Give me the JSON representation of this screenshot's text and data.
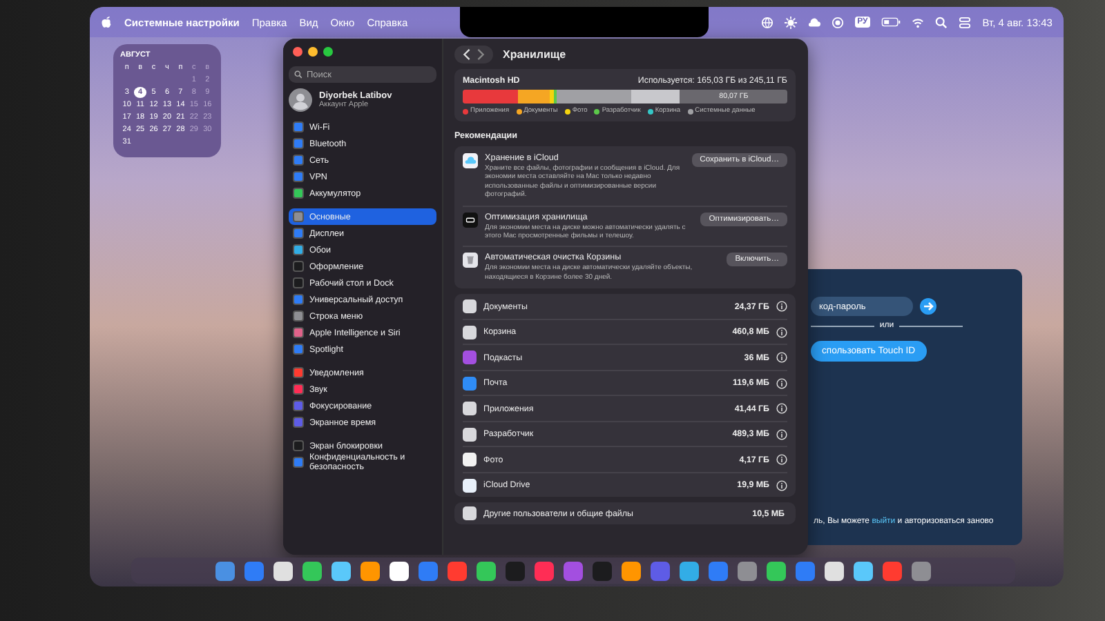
{
  "menu_bar": {
    "app_name": "Системные настройки",
    "menus": [
      "Правка",
      "Вид",
      "Окно",
      "Справка"
    ],
    "input_source": "РУ",
    "clock": "Вт, 4 авг. 13:43"
  },
  "calendar_widget": {
    "month": "АВГУСТ",
    "weekdays": [
      "п",
      "в",
      "с",
      "ч",
      "п",
      "с",
      "в"
    ],
    "weeks": [
      [
        {
          "day": "1",
          "selected": false
        },
        {
          "day": "2",
          "selected": false
        }
      ],
      [
        {
          "day": "3",
          "selected": false
        },
        {
          "day": "4",
          "selected": true
        },
        {
          "day": "5",
          "selected": false
        },
        {
          "day": "6",
          "selected": false
        },
        {
          "day": "7",
          "selected": false
        },
        {
          "day": "8",
          "selected": false
        },
        {
          "day": "9",
          "selected": false
        }
      ],
      [
        {
          "day": "10",
          "selected": false
        },
        {
          "day": "11",
          "selected": false
        },
        {
          "day": "12",
          "selected": false
        },
        {
          "day": "13",
          "selected": false
        },
        {
          "day": "14",
          "selected": false
        },
        {
          "day": "15",
          "selected": false
        },
        {
          "day": "16",
          "selected": false
        }
      ],
      [
        {
          "day": "17",
          "selected": false
        },
        {
          "day": "18",
          "selected": false
        },
        {
          "day": "19",
          "selected": false
        },
        {
          "day": "20",
          "selected": false
        },
        {
          "day": "21",
          "selected": false
        },
        {
          "day": "22",
          "selected": false
        },
        {
          "day": "23",
          "selected": false
        }
      ],
      [
        {
          "day": "24",
          "selected": false
        },
        {
          "day": "25",
          "selected": false
        },
        {
          "day": "26",
          "selected": false
        },
        {
          "day": "27",
          "selected": false
        },
        {
          "day": "28",
          "selected": false
        },
        {
          "day": "29",
          "selected": false
        },
        {
          "day": "30",
          "selected": false
        }
      ],
      [
        {
          "day": "31",
          "selected": false
        }
      ]
    ]
  },
  "settings_window": {
    "sidebar": {
      "search": {
        "placeholder": "Поиск"
      },
      "account": {
        "name": "Diyorbek Latibov",
        "subtitle": "Аккаунт Apple"
      },
      "groups": [
        [
          {
            "label": "Wi-Fi",
            "color": "#2f7cf6",
            "selected": false
          },
          {
            "label": "Bluetooth",
            "color": "#2f7cf6",
            "selected": false
          },
          {
            "label": "Сеть",
            "color": "#2f7cf6",
            "selected": false
          },
          {
            "label": "VPN",
            "color": "#2f7cf6",
            "selected": false
          },
          {
            "label": "Аккумулятор",
            "color": "#34c759",
            "selected": false
          }
        ],
        [
          {
            "label": "Основные",
            "color": "#8e8e93",
            "selected": true
          },
          {
            "label": "Дисплеи",
            "color": "#2f7cf6",
            "selected": false
          },
          {
            "label": "Обои",
            "color": "#32ade6",
            "selected": false
          },
          {
            "label": "Оформление",
            "color": "#1c1c1e",
            "selected": false
          },
          {
            "label": "Рабочий стол и Dock",
            "color": "#1c1c1e",
            "selected": false
          },
          {
            "label": "Универсальный доступ",
            "color": "#2f7cf6",
            "selected": false
          },
          {
            "label": "Строка меню",
            "color": "#8e8e93",
            "selected": false
          },
          {
            "label": "Apple Intelligence и Siri",
            "color": "#e0628a",
            "selected": false
          },
          {
            "label": "Spotlight",
            "color": "#2f7cf6",
            "selected": false
          }
        ],
        [
          {
            "label": "Уведомления",
            "color": "#ff3b30",
            "selected": false
          },
          {
            "label": "Звук",
            "color": "#ff2d55",
            "selected": false
          },
          {
            "label": "Фокусирование",
            "color": "#5e5ce6",
            "selected": false
          },
          {
            "label": "Экранное время",
            "color": "#5e5ce6",
            "selected": false
          }
        ],
        [
          {
            "label": "Экран блокировки",
            "color": "#1c1c1e",
            "selected": false
          },
          {
            "label": "Конфиденциальность и безопасность",
            "color": "#2f7cf6",
            "selected": false
          }
        ]
      ]
    },
    "title": "Хранилище",
    "storage": {
      "volume": "Macintosh HD",
      "usage": "Используется: 165,03 ГБ из 245,11 ГБ",
      "free": "80,07 ГБ",
      "segments": [
        {
          "color": "#e8393c"
        },
        {
          "color": "#f5a623"
        },
        {
          "color": "#f5d40f"
        },
        {
          "color": "#5cc94a"
        },
        {
          "color": "#a0a0a4"
        },
        {
          "color": "#c8c8cc"
        }
      ],
      "legend": [
        {
          "label": "Приложения",
          "color": "#e8393c"
        },
        {
          "label": "Документы",
          "color": "#f5a623"
        },
        {
          "label": "Фото",
          "color": "#f5d40f"
        },
        {
          "label": "Разработчик",
          "color": "#5cc94a"
        },
        {
          "label": "Корзина",
          "color": "#35c6c6"
        },
        {
          "label": "Системные данные",
          "color": "#a0a0a4"
        }
      ]
    },
    "recommendations_title": "Рекомендации",
    "recommendations": [
      {
        "kind": "cloud",
        "title": "Хранение в iCloud",
        "description": "Храните все файлы, фотографии и сообщения в iCloud. Для экономии места оставляйте на Mac только недавно использованные файлы и оптимизированные версии фотографий.",
        "button": "Сохранить в iCloud…"
      },
      {
        "kind": "tv",
        "title": "Оптимизация хранилища",
        "description": "Для экономии места на диске можно автоматически удалять с этого Mac просмотренные фильмы и телешоу.",
        "button": "Оптимизировать…"
      },
      {
        "kind": "trash",
        "title": "Автоматическая очистка Корзины",
        "description": "Для экономии места на диске автоматически удаляйте объекты, находящиеся в Корзине более 30 дней.",
        "button": "Включить…"
      }
    ],
    "categories": [
      {
        "name": "Документы",
        "size": "24,37 ГБ",
        "color": "#d8d8dc"
      },
      {
        "name": "Корзина",
        "size": "460,8 МБ",
        "color": "#d8d8dc"
      },
      {
        "name": "Подкасты",
        "size": "36 МБ",
        "color": "#a34fe0"
      },
      {
        "name": "Почта",
        "size": "119,6 МБ",
        "color": "#2f8cf6"
      },
      {
        "name": "Приложения",
        "size": "41,44 ГБ",
        "color": "#d8d8dc"
      },
      {
        "name": "Разработчик",
        "size": "489,3 МБ",
        "color": "#d8d8dc"
      },
      {
        "name": "Фото",
        "size": "4,17 ГБ",
        "color": "#f2f2f2"
      },
      {
        "name": "iCloud Drive",
        "size": "19,9 МБ",
        "color": "#e8f0fa"
      }
    ],
    "other": {
      "name": "Другие пользователи и общие файлы",
      "size": "10,5 МБ"
    }
  },
  "login_window": {
    "password": {
      "placeholder": "код-пароль"
    },
    "divider": "или",
    "touch_id_button": "спользовать Touch ID",
    "footer": "ль, Вы можете ",
    "footer_link": "выйти",
    "footer_end": " и авторизоваться заново"
  }
}
